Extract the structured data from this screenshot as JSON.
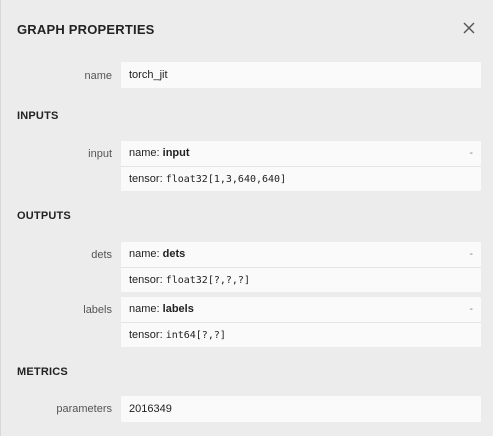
{
  "header": {
    "title": "GRAPH PROPERTIES"
  },
  "model": {
    "name_label": "name",
    "name_value": "torch_jit"
  },
  "inputs": {
    "heading": "INPUTS",
    "items": [
      {
        "label": "input",
        "name_prefix": "name: ",
        "name": "input",
        "tensor_prefix": "tensor: ",
        "tensor": "float32[1,3,640,640]",
        "expand": "-"
      }
    ]
  },
  "outputs": {
    "heading": "OUTPUTS",
    "items": [
      {
        "label": "dets",
        "name_prefix": "name: ",
        "name": "dets",
        "tensor_prefix": "tensor: ",
        "tensor": "float32[?,?,?]",
        "expand": "-"
      },
      {
        "label": "labels",
        "name_prefix": "name: ",
        "name": "labels",
        "tensor_prefix": "tensor: ",
        "tensor": "int64[?,?]",
        "expand": "-"
      }
    ]
  },
  "metrics": {
    "heading": "METRICS",
    "parameters_label": "parameters",
    "parameters_value": "2016349"
  },
  "icons": {
    "close": "close-icon"
  }
}
